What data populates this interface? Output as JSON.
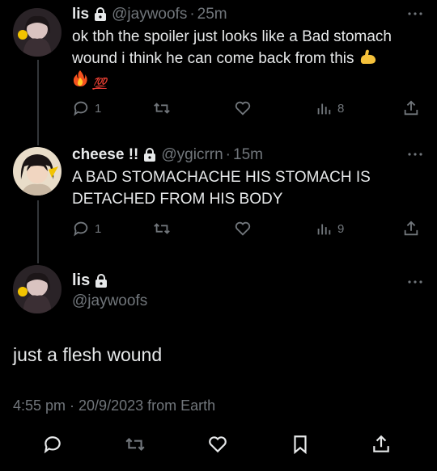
{
  "tweets": [
    {
      "name": "lis",
      "handle": "@jaywoofs",
      "time": "25m",
      "text": "ok tbh the spoiler just looks like a Bad stomach wound i think  he can come back from this",
      "emoji_text": "💯",
      "replies": "1",
      "views": "8"
    },
    {
      "name": "cheese !!",
      "handle": "@ygicrrn",
      "time": "15m",
      "text": "A BAD STOMACHACHE HIS STOMACH IS DETACHED FROM HIS BODY",
      "replies": "1",
      "views": "9"
    }
  ],
  "focus": {
    "name": "lis",
    "handle": "@jaywoofs",
    "text": "just a flesh wound",
    "timestamp": "4:55 pm · 20/9/2023 from Earth"
  },
  "colors": {
    "background": "#000000",
    "text": "#e7e9ea",
    "muted": "#71767b",
    "divider": "#333639"
  },
  "icons": [
    "lock-icon",
    "more-icon",
    "reply-icon",
    "retweet-icon",
    "like-icon",
    "views-icon",
    "share-icon",
    "bookmark-icon"
  ]
}
